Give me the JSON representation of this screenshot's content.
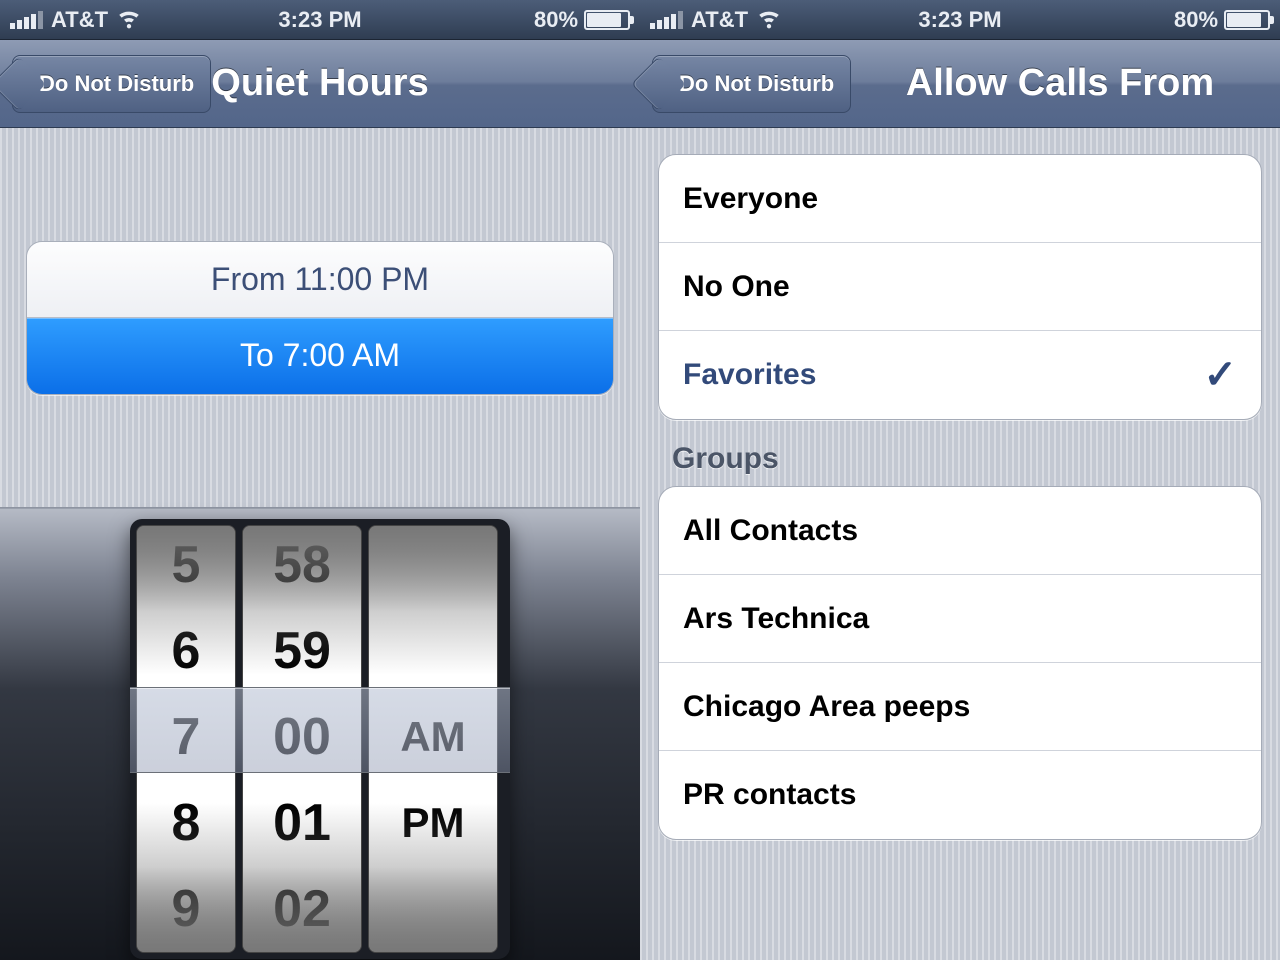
{
  "status": {
    "carrier": "AT&T",
    "time": "3:23 PM",
    "battery_pct": "80%",
    "battery_fill_pct": 80
  },
  "left": {
    "back_label": "Do Not Disturb",
    "title": "Quiet Hours",
    "from_row": "From 11:00 PM",
    "to_row": "To 7:00 AM",
    "picker": {
      "hours": [
        "5",
        "6",
        "7",
        "8",
        "9"
      ],
      "minutes": [
        "58",
        "59",
        "00",
        "01",
        "02"
      ],
      "ampm": [
        "",
        "",
        "AM",
        "PM",
        ""
      ]
    }
  },
  "right": {
    "back_label": "Do Not Disturb",
    "title": "Allow Calls From",
    "primary": [
      {
        "label": "Everyone",
        "selected": false
      },
      {
        "label": "No One",
        "selected": false
      },
      {
        "label": "Favorites",
        "selected": true
      }
    ],
    "groups_header": "Groups",
    "groups": [
      {
        "label": "All Contacts"
      },
      {
        "label": "Ars Technica"
      },
      {
        "label": "Chicago Area peeps"
      },
      {
        "label": "PR contacts"
      }
    ]
  }
}
